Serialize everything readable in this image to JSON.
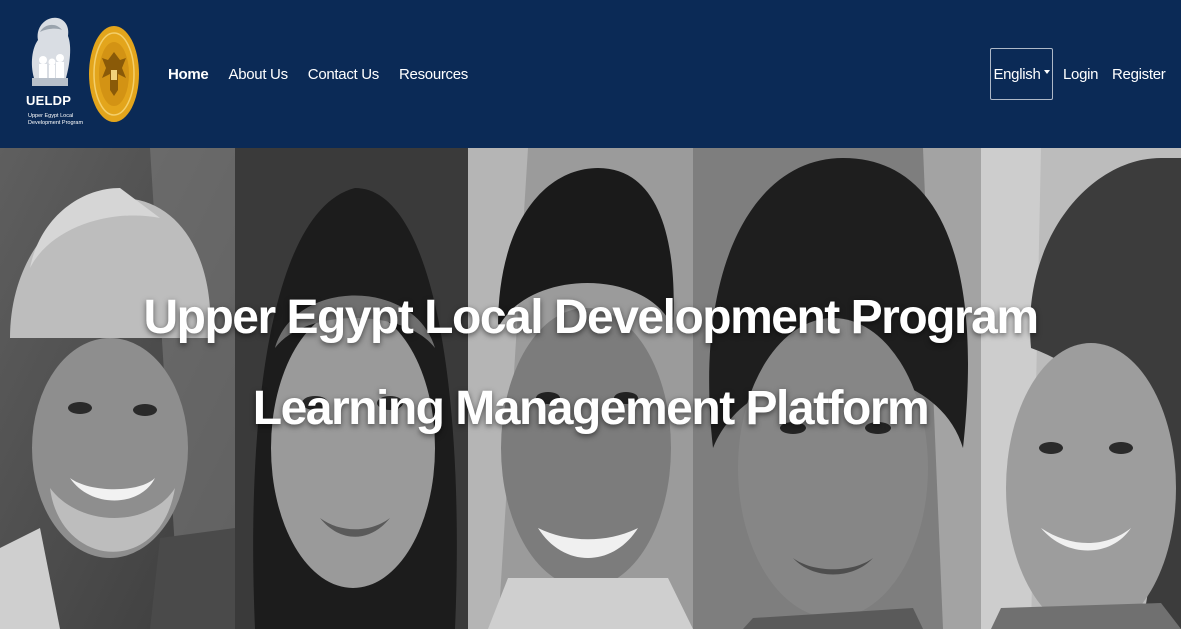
{
  "header": {
    "logo_abbr": "UELDP",
    "logo_subtitle": "Upper Egypt Local Development Program",
    "logo_icon": "family-tree-logo",
    "seal_icon": "egypt-eagle-seal",
    "nav": [
      {
        "label": "Home",
        "active": true
      },
      {
        "label": "About Us",
        "active": false
      },
      {
        "label": "Contact Us",
        "active": false
      },
      {
        "label": "Resources",
        "active": false
      }
    ],
    "language": "English",
    "login_label": "Login",
    "register_label": "Register"
  },
  "hero": {
    "title_line1": "Upper Egypt Local Development Program",
    "title_line2": "Learning Management Platform"
  },
  "colors": {
    "navbar_bg": "#0b2a56",
    "text": "#ffffff",
    "seal_gold": "#e3a51c"
  }
}
